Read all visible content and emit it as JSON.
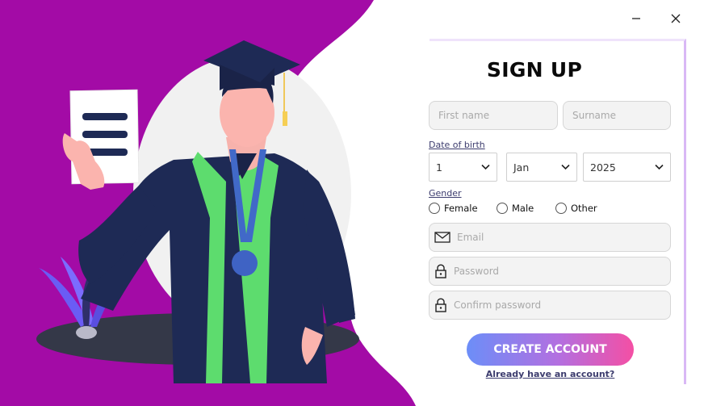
{
  "window": {
    "minimize_icon": "minimize-icon",
    "close_icon": "close-icon"
  },
  "form": {
    "title": "SIGN UP",
    "first_name_placeholder": "First name",
    "surname_placeholder": "Surname",
    "dob_label": "Date of birth",
    "dob": {
      "day": "1",
      "month": "Jan",
      "year": "2025"
    },
    "gender_label": "Gender",
    "gender_options": [
      "Female",
      "Male",
      "Other"
    ],
    "email_placeholder": "Email",
    "password_placeholder": "Password",
    "confirm_password_placeholder": "Confirm password",
    "submit_label": "CREATE ACCOUNT",
    "login_link": "Already have an account?"
  },
  "colors": {
    "accent_purple": "#a30ba6",
    "gown_navy": "#1e2a55",
    "stole_green": "#5ddc6e",
    "button_gradient_start": "#6c8ef8",
    "button_gradient_end": "#f44fa4"
  }
}
